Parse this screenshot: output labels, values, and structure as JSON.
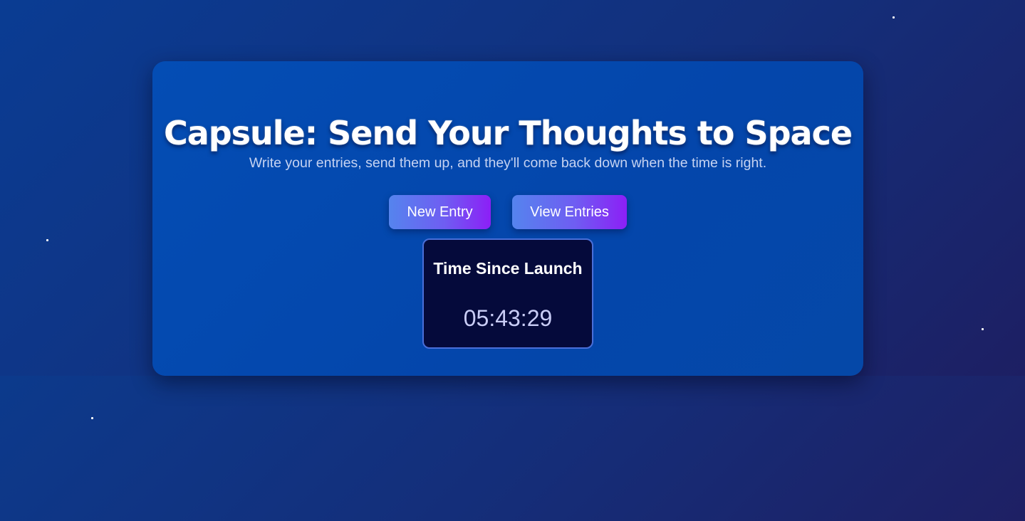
{
  "header": {
    "title": "Capsule: Send Your Thoughts to Space",
    "subtitle": "Write your entries, send them up, and they'll come back down when the time is right."
  },
  "actions": {
    "new_entry_label": "New Entry",
    "view_entries_label": "View Entries"
  },
  "timer": {
    "label": "Time Since Launch",
    "value": "05:43:29"
  },
  "colors": {
    "card": "#044db4",
    "timer_bg": "#050a3b",
    "button_start": "#5584ee",
    "button_end": "#8c1ff6"
  }
}
